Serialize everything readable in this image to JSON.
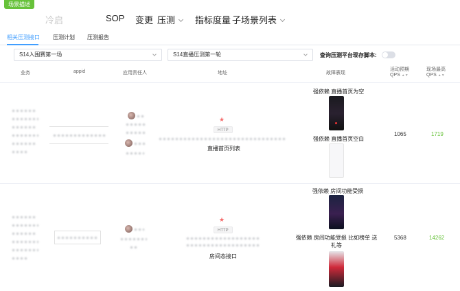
{
  "badge": "场景描述",
  "nav": {
    "items": [
      "冷启",
      "SOP",
      "变更",
      "压测",
      "指标度量",
      "子场景列表"
    ]
  },
  "tabs": [
    "相关压测接口",
    "压测计划",
    "压测报告"
  ],
  "filters": {
    "select1": "S14入围赛第一场",
    "select2": "S14直播压测第一轮",
    "toggle_label": "查询压测平台现存脚本:"
  },
  "table": {
    "headers": {
      "business": "业务",
      "appid": "appid",
      "owner": "应用责任人",
      "address": "地址",
      "fault": "故障表现",
      "expected_qps_1": "活动预期",
      "expected_qps_2": "QPS",
      "peak_qps_1": "现场最高",
      "peak_qps_2": "QPS"
    },
    "rows": [
      {
        "tag": "HTTP",
        "api_name": "直播首页列表",
        "fault_1": "强依赖 直播首页为空",
        "fault_2": "强依赖 直播首页空白",
        "expected_qps": "1065",
        "peak_qps": "1719"
      },
      {
        "tag": "HTTP",
        "api_name": "房间态接口",
        "fault_1": "强依赖 房间功能受损",
        "fault_2": "强依赖 房间功能受损 比如榜单 送礼等",
        "expected_qps": "5368",
        "peak_qps": "14262"
      }
    ]
  },
  "icons": {
    "star": "★",
    "sort": "▲▼"
  },
  "colors": {
    "accent": "#409eff",
    "green": "#67c23a",
    "star": "#f56c6c"
  }
}
